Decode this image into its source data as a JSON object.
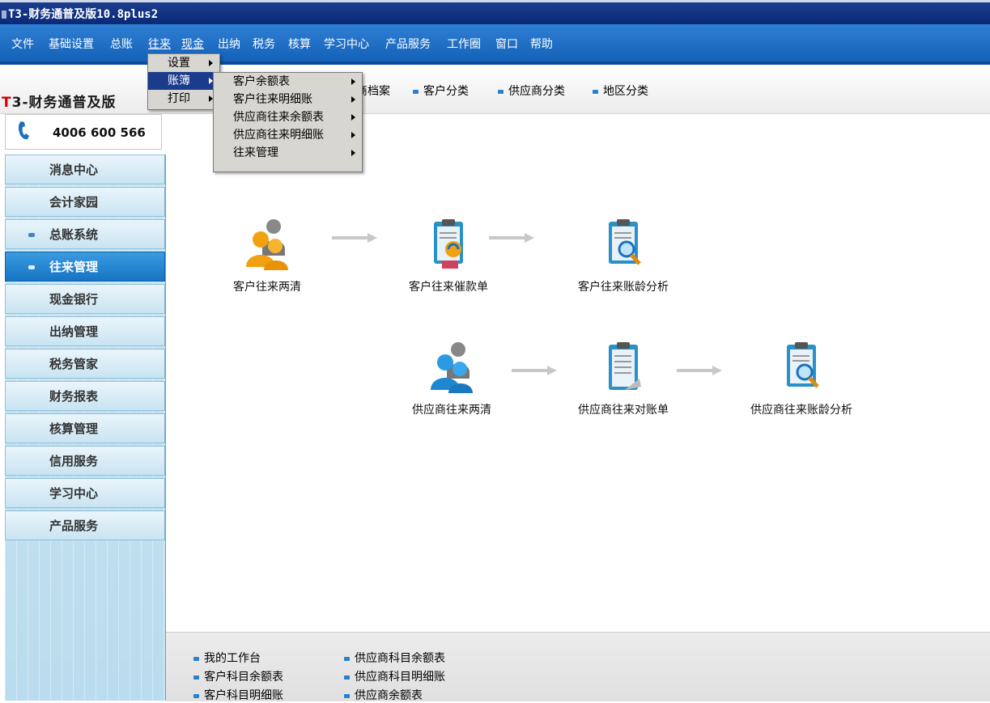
{
  "window": {
    "title": "T3-财务通普及版10.8plus2"
  },
  "menubar": {
    "items": [
      "文件",
      "基础设置",
      "总账",
      "往来",
      "现金",
      "出纳",
      "税务",
      "核算",
      "学习中心",
      "产品服务",
      "工作圈",
      "窗口",
      "帮助"
    ]
  },
  "dropdown1": {
    "items": [
      "设置",
      "账簿",
      "打印"
    ]
  },
  "dropdown2": {
    "items": [
      "客户余额表",
      "客户往来明细账",
      "供应商往来余额表",
      "供应商往来明细账",
      "往来管理"
    ]
  },
  "brand": {
    "red": "T",
    "rest": "3-财务通普及版"
  },
  "phone": "4006 600 566",
  "sidebar": {
    "items": [
      {
        "label": "消息中心"
      },
      {
        "label": "会计家园"
      },
      {
        "label": "总账系统"
      },
      {
        "label": "往来管理"
      },
      {
        "label": "现金银行"
      },
      {
        "label": "出纳管理"
      },
      {
        "label": "税务管家"
      },
      {
        "label": "财务报表"
      },
      {
        "label": "核算管理"
      },
      {
        "label": "信用服务"
      },
      {
        "label": "学习中心"
      },
      {
        "label": "产品服务"
      }
    ]
  },
  "shortcuts": [
    "商档案",
    "客户分类",
    "供应商分类",
    "地区分类"
  ],
  "workflow": {
    "customer": [
      "客户往来两清",
      "客户往来催款单",
      "客户往来账龄分析"
    ],
    "supplier": [
      "供应商往来两清",
      "供应商往来对账单",
      "供应商往来账龄分析"
    ]
  },
  "bottom_links": {
    "col1": [
      "我的工作台",
      "客户科目余额表",
      "客户科目明细账"
    ],
    "col2": [
      "供应商科目余额表",
      "供应商科目明细账",
      "供应商余额表"
    ]
  },
  "colors": {
    "titlebar": "#0a2a78",
    "menubar": "#1462b8",
    "accent": "#1674c4",
    "brand_red": "#d40000"
  }
}
